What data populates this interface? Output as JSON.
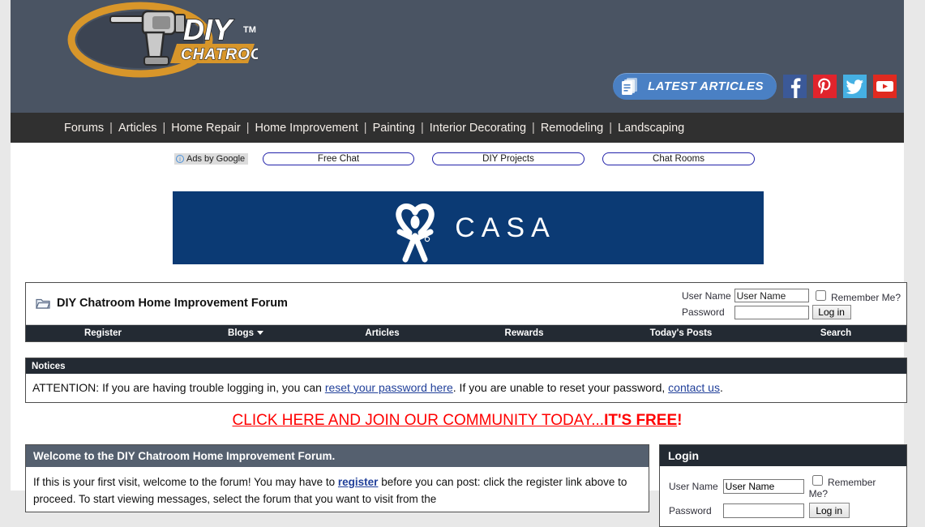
{
  "site": {
    "logo_main": "DIY",
    "logo_sub": "CHATROOM",
    "logo_tm": "TM"
  },
  "header": {
    "latest_articles_label": "LATEST ARTICLES",
    "social": [
      {
        "name": "facebook",
        "glyph": "f",
        "color": "#3b5998"
      },
      {
        "name": "pinterest",
        "glyph": "P",
        "color": "#e0242c"
      },
      {
        "name": "twitter",
        "glyph": "t",
        "color": "#45b0e3"
      },
      {
        "name": "youtube",
        "glyph": "You",
        "color": "#e02a20"
      }
    ]
  },
  "main_nav": {
    "items": [
      "Forums",
      "Articles",
      "Home Repair",
      "Home Improvement",
      "Painting",
      "Interior Decorating",
      "Remodeling",
      "Landscaping"
    ],
    "separator": "|"
  },
  "ads": {
    "by_google_label": "Ads by Google",
    "info_glyph": "i",
    "pills": [
      "Free Chat",
      "DIY Projects",
      "Chat Rooms"
    ]
  },
  "banner": {
    "advertiser": "CASA",
    "bg_color": "#0b3a74"
  },
  "forum": {
    "title": "DIY Chatroom Home Improvement Forum",
    "header_login": {
      "username_label": "User Name",
      "username_value": "User Name",
      "password_label": "Password",
      "password_value": "",
      "remember_label": "Remember Me?",
      "login_button": "Log in"
    },
    "nav_items": [
      {
        "label": "Register",
        "has_caret": false
      },
      {
        "label": "Blogs",
        "has_caret": true
      },
      {
        "label": "Articles",
        "has_caret": false
      },
      {
        "label": "Rewards",
        "has_caret": false
      },
      {
        "label": "Today's Posts",
        "has_caret": false
      },
      {
        "label": "Search",
        "has_caret": false
      }
    ]
  },
  "notices": {
    "title": "Notices",
    "text_before": "ATTENTION: If you are having trouble logging in, you can ",
    "link1": "reset your password here",
    "text_middle": ". If you are unable to reset your password, ",
    "link2": "contact us",
    "text_after": "."
  },
  "join_banner": {
    "text_main": "CLICK HERE AND JOIN OUR COMMUNITY TODAY...",
    "text_bold": "IT'S FREE",
    "text_end": "!"
  },
  "welcome": {
    "title": "Welcome to the DIY Chatroom Home Improvement Forum.",
    "body_1": "If this is your first visit, welcome to the forum! You may have to ",
    "body_link": "register",
    "body_2": " before you can post: click the",
    "body_3": "register link above to proceed. To start viewing messages, select the forum that you want to visit from the"
  },
  "login_panel": {
    "title": "Login",
    "username_label": "User Name",
    "username_value": "User Name",
    "password_label": "Password",
    "password_value": "",
    "remember_label": "Remember Me?",
    "login_button": "Log in"
  }
}
